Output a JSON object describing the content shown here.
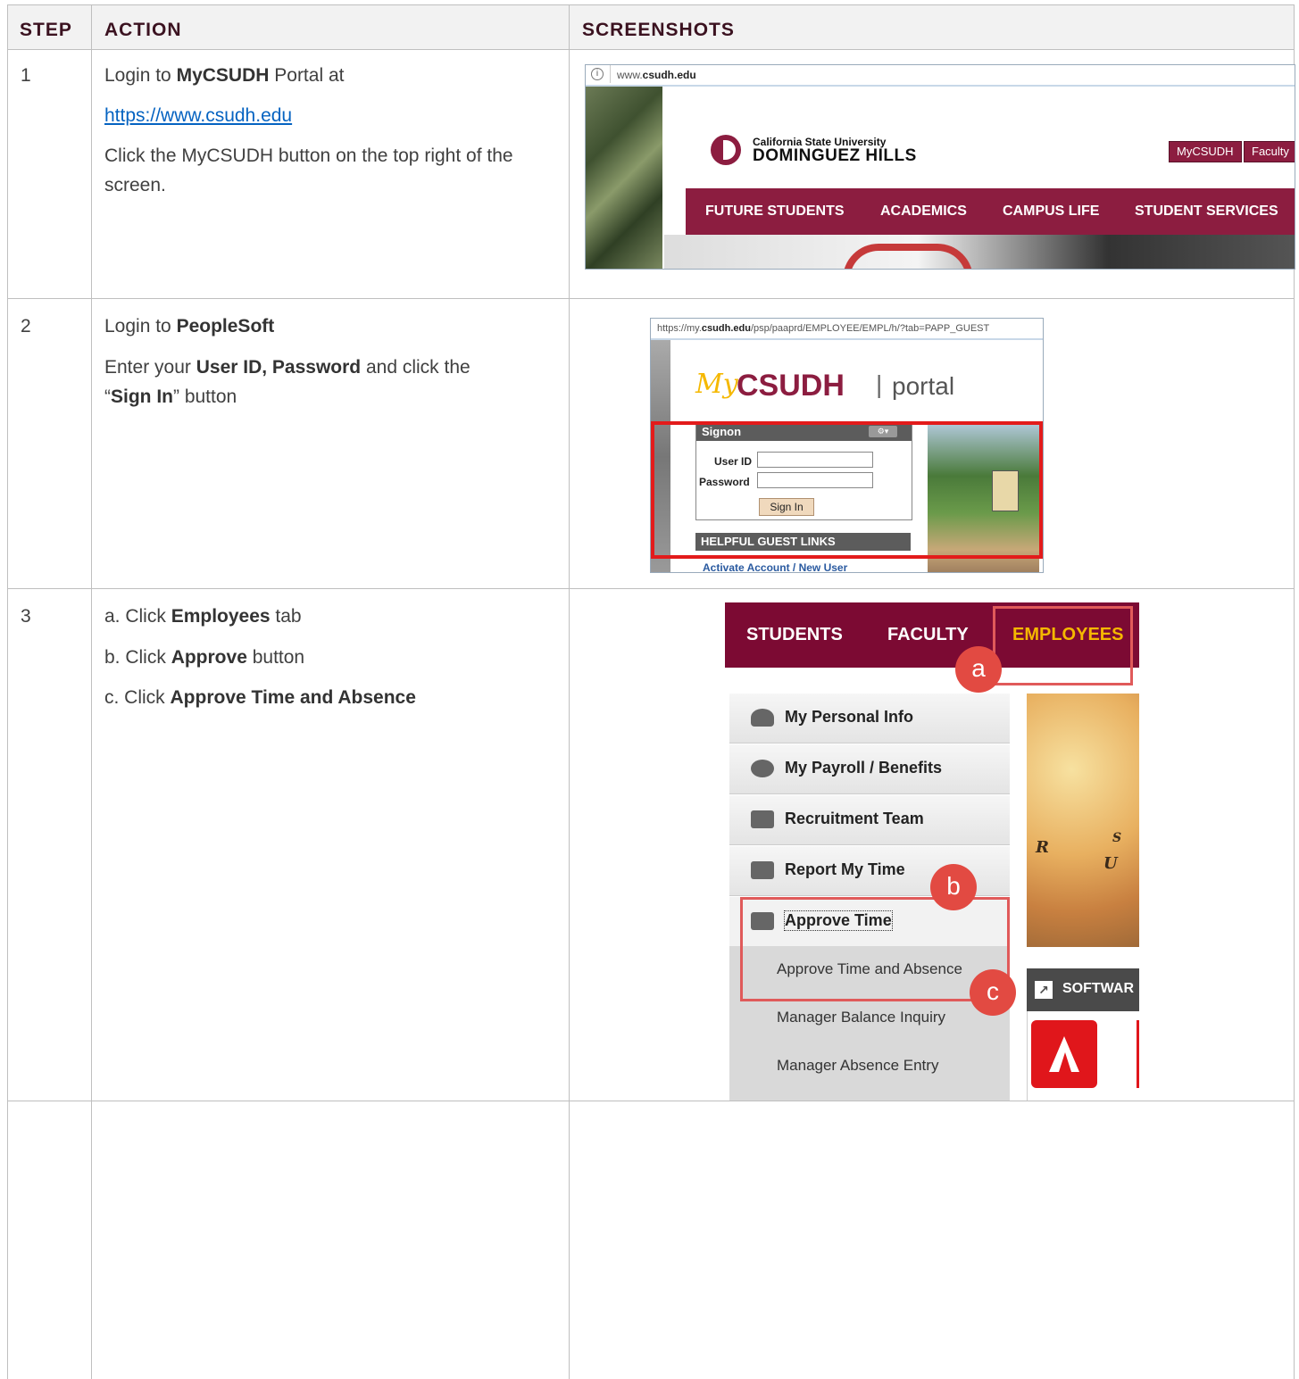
{
  "headers": {
    "step": "STEP",
    "action": "ACTION",
    "screenshots": "SCREENSHOTS"
  },
  "step1": {
    "num": "1",
    "line1_pre": "Login to ",
    "line1_bold": "MyCSUDH",
    "line1_post": " Portal at",
    "link": "https://www.csudh.edu",
    "line3": "Click the MyCSUDH button on the top right of the screen.",
    "shot": {
      "url_prefix": "www.",
      "url_bold": "csudh.edu",
      "logo_line1": "California State University",
      "logo_line2": "DOMINGUEZ HILLS",
      "top_buttons": [
        "MyCSUDH",
        "Faculty"
      ],
      "nav": [
        "FUTURE STUDENTS",
        "ACADEMICS",
        "CAMPUS LIFE",
        "STUDENT SERVICES"
      ]
    }
  },
  "step2": {
    "num": "2",
    "line1_pre": "Login to ",
    "line1_bold": "PeopleSoft",
    "line2_pre": "Enter your ",
    "line2_bold": "User ID, Password",
    "line2_post": " and click the",
    "line3_pre": "“",
    "line3_bold": "Sign In",
    "line3_post": "” button",
    "shot": {
      "url_pre": "https://my.",
      "url_bold": "csudh.edu",
      "url_post": "/psp/paaprd/EMPLOYEE/EMPL/h/?tab=PAPP_GUEST",
      "brand_my": "My",
      "brand_main": "CSUDH",
      "brand_sep": "|",
      "brand_portal": "portal",
      "signon_title": "Signon",
      "userid_label": "User ID",
      "password_label": "Password",
      "signin_button": "Sign In",
      "guest_links_title": "HELPFUL GUEST LINKS",
      "guest_link": "Activate Account / New User"
    }
  },
  "step3": {
    "num": "3",
    "a_pre": "a.  Click ",
    "a_bold": "Employees",
    "a_post": " tab",
    "b_pre": "b.  Click ",
    "b_bold": "Approve",
    "b_post": " button",
    "c_pre": "c.  Click ",
    "c_bold": "Approve Time and Absence",
    "shot": {
      "tabs": [
        "STUDENTS",
        "FACULTY",
        "EMPLOYEES"
      ],
      "menu": [
        "My Personal Info",
        "My Payroll / Benefits",
        "Recruitment Team",
        "Report My Time",
        "Approve Time"
      ],
      "submenu": [
        "Approve Time and Absence",
        "Manager Balance Inquiry",
        "Manager Absence Entry"
      ],
      "badges": [
        "a",
        "b",
        "c"
      ],
      "software_label": "SOFTWAR",
      "map_letters": [
        "R",
        "U",
        "S"
      ]
    }
  },
  "colors": {
    "maroon": "#8c1d40",
    "tab_maroon": "#7c0a33",
    "employees_gold": "#f5b800",
    "annotation_red": "#e24a42",
    "link_blue": "#0563c1"
  }
}
